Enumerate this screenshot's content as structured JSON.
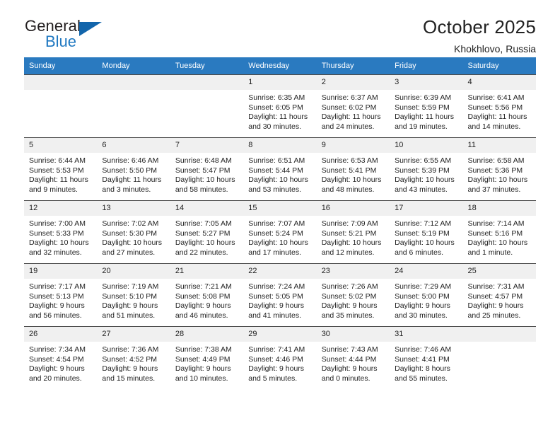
{
  "brand": {
    "name_part1": "General",
    "name_part2": "Blue",
    "triangle_color": "#1265ab",
    "blue_color": "#1f78c1"
  },
  "header": {
    "title": "October 2025",
    "location": "Khokhlovo, Russia",
    "header_bg_color": "#2a7ac0"
  },
  "weekday_headers": [
    "Sunday",
    "Monday",
    "Tuesday",
    "Wednesday",
    "Thursday",
    "Friday",
    "Saturday"
  ],
  "labels": {
    "sunrise_prefix": "Sunrise:",
    "sunset_prefix": "Sunset:",
    "daylight_prefix": "Daylight:"
  },
  "weeks": [
    [
      {
        "day": "",
        "sunrise": "",
        "sunset": "",
        "daylight_line1": "",
        "daylight_line2": ""
      },
      {
        "day": "",
        "sunrise": "",
        "sunset": "",
        "daylight_line1": "",
        "daylight_line2": ""
      },
      {
        "day": "",
        "sunrise": "",
        "sunset": "",
        "daylight_line1": "",
        "daylight_line2": ""
      },
      {
        "day": "1",
        "sunrise": "Sunrise: 6:35 AM",
        "sunset": "Sunset: 6:05 PM",
        "daylight_line1": "Daylight: 11 hours",
        "daylight_line2": "and 30 minutes."
      },
      {
        "day": "2",
        "sunrise": "Sunrise: 6:37 AM",
        "sunset": "Sunset: 6:02 PM",
        "daylight_line1": "Daylight: 11 hours",
        "daylight_line2": "and 24 minutes."
      },
      {
        "day": "3",
        "sunrise": "Sunrise: 6:39 AM",
        "sunset": "Sunset: 5:59 PM",
        "daylight_line1": "Daylight: 11 hours",
        "daylight_line2": "and 19 minutes."
      },
      {
        "day": "4",
        "sunrise": "Sunrise: 6:41 AM",
        "sunset": "Sunset: 5:56 PM",
        "daylight_line1": "Daylight: 11 hours",
        "daylight_line2": "and 14 minutes."
      }
    ],
    [
      {
        "day": "5",
        "sunrise": "Sunrise: 6:44 AM",
        "sunset": "Sunset: 5:53 PM",
        "daylight_line1": "Daylight: 11 hours",
        "daylight_line2": "and 9 minutes."
      },
      {
        "day": "6",
        "sunrise": "Sunrise: 6:46 AM",
        "sunset": "Sunset: 5:50 PM",
        "daylight_line1": "Daylight: 11 hours",
        "daylight_line2": "and 3 minutes."
      },
      {
        "day": "7",
        "sunrise": "Sunrise: 6:48 AM",
        "sunset": "Sunset: 5:47 PM",
        "daylight_line1": "Daylight: 10 hours",
        "daylight_line2": "and 58 minutes."
      },
      {
        "day": "8",
        "sunrise": "Sunrise: 6:51 AM",
        "sunset": "Sunset: 5:44 PM",
        "daylight_line1": "Daylight: 10 hours",
        "daylight_line2": "and 53 minutes."
      },
      {
        "day": "9",
        "sunrise": "Sunrise: 6:53 AM",
        "sunset": "Sunset: 5:41 PM",
        "daylight_line1": "Daylight: 10 hours",
        "daylight_line2": "and 48 minutes."
      },
      {
        "day": "10",
        "sunrise": "Sunrise: 6:55 AM",
        "sunset": "Sunset: 5:39 PM",
        "daylight_line1": "Daylight: 10 hours",
        "daylight_line2": "and 43 minutes."
      },
      {
        "day": "11",
        "sunrise": "Sunrise: 6:58 AM",
        "sunset": "Sunset: 5:36 PM",
        "daylight_line1": "Daylight: 10 hours",
        "daylight_line2": "and 37 minutes."
      }
    ],
    [
      {
        "day": "12",
        "sunrise": "Sunrise: 7:00 AM",
        "sunset": "Sunset: 5:33 PM",
        "daylight_line1": "Daylight: 10 hours",
        "daylight_line2": "and 32 minutes."
      },
      {
        "day": "13",
        "sunrise": "Sunrise: 7:02 AM",
        "sunset": "Sunset: 5:30 PM",
        "daylight_line1": "Daylight: 10 hours",
        "daylight_line2": "and 27 minutes."
      },
      {
        "day": "14",
        "sunrise": "Sunrise: 7:05 AM",
        "sunset": "Sunset: 5:27 PM",
        "daylight_line1": "Daylight: 10 hours",
        "daylight_line2": "and 22 minutes."
      },
      {
        "day": "15",
        "sunrise": "Sunrise: 7:07 AM",
        "sunset": "Sunset: 5:24 PM",
        "daylight_line1": "Daylight: 10 hours",
        "daylight_line2": "and 17 minutes."
      },
      {
        "day": "16",
        "sunrise": "Sunrise: 7:09 AM",
        "sunset": "Sunset: 5:21 PM",
        "daylight_line1": "Daylight: 10 hours",
        "daylight_line2": "and 12 minutes."
      },
      {
        "day": "17",
        "sunrise": "Sunrise: 7:12 AM",
        "sunset": "Sunset: 5:19 PM",
        "daylight_line1": "Daylight: 10 hours",
        "daylight_line2": "and 6 minutes."
      },
      {
        "day": "18",
        "sunrise": "Sunrise: 7:14 AM",
        "sunset": "Sunset: 5:16 PM",
        "daylight_line1": "Daylight: 10 hours",
        "daylight_line2": "and 1 minute."
      }
    ],
    [
      {
        "day": "19",
        "sunrise": "Sunrise: 7:17 AM",
        "sunset": "Sunset: 5:13 PM",
        "daylight_line1": "Daylight: 9 hours",
        "daylight_line2": "and 56 minutes."
      },
      {
        "day": "20",
        "sunrise": "Sunrise: 7:19 AM",
        "sunset": "Sunset: 5:10 PM",
        "daylight_line1": "Daylight: 9 hours",
        "daylight_line2": "and 51 minutes."
      },
      {
        "day": "21",
        "sunrise": "Sunrise: 7:21 AM",
        "sunset": "Sunset: 5:08 PM",
        "daylight_line1": "Daylight: 9 hours",
        "daylight_line2": "and 46 minutes."
      },
      {
        "day": "22",
        "sunrise": "Sunrise: 7:24 AM",
        "sunset": "Sunset: 5:05 PM",
        "daylight_line1": "Daylight: 9 hours",
        "daylight_line2": "and 41 minutes."
      },
      {
        "day": "23",
        "sunrise": "Sunrise: 7:26 AM",
        "sunset": "Sunset: 5:02 PM",
        "daylight_line1": "Daylight: 9 hours",
        "daylight_line2": "and 35 minutes."
      },
      {
        "day": "24",
        "sunrise": "Sunrise: 7:29 AM",
        "sunset": "Sunset: 5:00 PM",
        "daylight_line1": "Daylight: 9 hours",
        "daylight_line2": "and 30 minutes."
      },
      {
        "day": "25",
        "sunrise": "Sunrise: 7:31 AM",
        "sunset": "Sunset: 4:57 PM",
        "daylight_line1": "Daylight: 9 hours",
        "daylight_line2": "and 25 minutes."
      }
    ],
    [
      {
        "day": "26",
        "sunrise": "Sunrise: 7:34 AM",
        "sunset": "Sunset: 4:54 PM",
        "daylight_line1": "Daylight: 9 hours",
        "daylight_line2": "and 20 minutes."
      },
      {
        "day": "27",
        "sunrise": "Sunrise: 7:36 AM",
        "sunset": "Sunset: 4:52 PM",
        "daylight_line1": "Daylight: 9 hours",
        "daylight_line2": "and 15 minutes."
      },
      {
        "day": "28",
        "sunrise": "Sunrise: 7:38 AM",
        "sunset": "Sunset: 4:49 PM",
        "daylight_line1": "Daylight: 9 hours",
        "daylight_line2": "and 10 minutes."
      },
      {
        "day": "29",
        "sunrise": "Sunrise: 7:41 AM",
        "sunset": "Sunset: 4:46 PM",
        "daylight_line1": "Daylight: 9 hours",
        "daylight_line2": "and 5 minutes."
      },
      {
        "day": "30",
        "sunrise": "Sunrise: 7:43 AM",
        "sunset": "Sunset: 4:44 PM",
        "daylight_line1": "Daylight: 9 hours",
        "daylight_line2": "and 0 minutes."
      },
      {
        "day": "31",
        "sunrise": "Sunrise: 7:46 AM",
        "sunset": "Sunset: 4:41 PM",
        "daylight_line1": "Daylight: 8 hours",
        "daylight_line2": "and 55 minutes."
      },
      {
        "day": "",
        "sunrise": "",
        "sunset": "",
        "daylight_line1": "",
        "daylight_line2": ""
      }
    ]
  ]
}
